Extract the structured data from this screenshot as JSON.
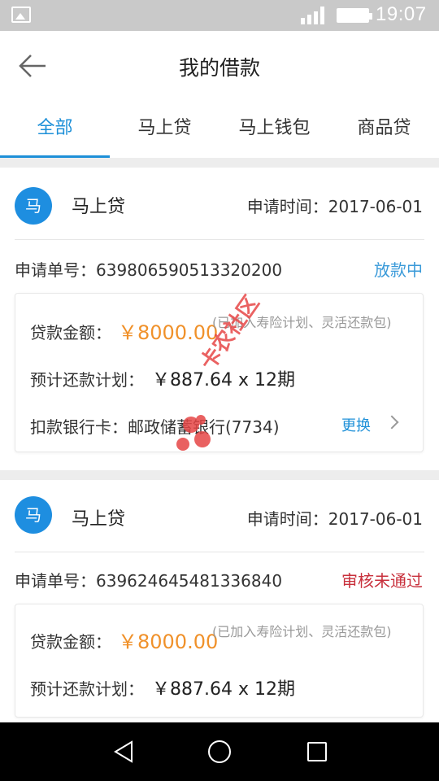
{
  "status_bar": {
    "time": "19:07",
    "icons": [
      "image-icon",
      "signal-icon",
      "battery-icon"
    ]
  },
  "header": {
    "title": "我的借款",
    "back_icon": "back-arrow-icon"
  },
  "tabs": [
    {
      "label": "全部",
      "active": true
    },
    {
      "label": "马上贷",
      "active": false
    },
    {
      "label": "马上钱包",
      "active": false
    },
    {
      "label": "商品贷",
      "active": false
    }
  ],
  "loans": [
    {
      "avatar_char": "马",
      "product": "马上贷",
      "apply_time_label": "申请时间：",
      "apply_time": "2017-06-01",
      "order_label": "申请单号：",
      "order_no": "639806590513320200",
      "status": "放款中",
      "status_color": "#3a9ad9",
      "amount_label": "贷款金额：",
      "amount": "￥8000.00",
      "amount_note": "(已加入寿险计划、灵活还款包)",
      "plan_label": "预计还款计划：",
      "plan": "￥887.64 x 12期",
      "bank_label": "扣款银行卡：",
      "bank": "邮政储蓄银行(7734)",
      "change_label": "更换"
    },
    {
      "avatar_char": "马",
      "product": "马上贷",
      "apply_time_label": "申请时间：",
      "apply_time": "2017-06-01",
      "order_label": "申请单号：",
      "order_no": "639624645481336840",
      "status": "审核未通过",
      "status_color": "#c8303c",
      "amount_label": "贷款金额：",
      "amount": "￥8000.00",
      "amount_note": "(已加入寿险计划、灵活还款包)",
      "plan_label": "预计还款计划：",
      "plan": "￥887.64 x 12期"
    }
  ],
  "watermark": {
    "text": "卡农社区",
    "color": "#e64646"
  },
  "colors": {
    "accent": "#1e90d8",
    "amount": "#f0912a"
  }
}
